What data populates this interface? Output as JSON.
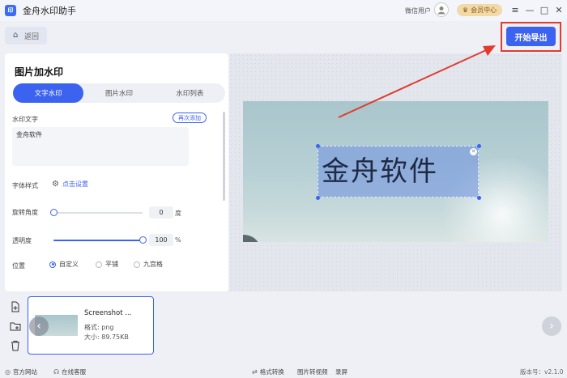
{
  "app": {
    "logo_text": "印",
    "title": "金舟水印助手"
  },
  "titlebar": {
    "user_name": "微信用户",
    "vip_label": "会员中心",
    "menu_icon": "≡",
    "minimize_icon": "—",
    "maximize_icon": "□",
    "close_icon": "✕"
  },
  "toolbar": {
    "back_label": "返回",
    "export_label": "开始导出"
  },
  "panel": {
    "title": "图片加水印",
    "tabs": [
      {
        "label": "文字水印",
        "active": true
      },
      {
        "label": "图片水印",
        "active": false
      },
      {
        "label": "水印列表",
        "active": false
      }
    ],
    "wm_text_label": "水印文字",
    "add_again_label": "再次添加",
    "wm_text_value": "金舟软件",
    "font_style_label": "字体样式",
    "font_setting_link": "点击设置",
    "rotation_label": "旋转角度",
    "rotation_value": "0",
    "rotation_unit": "度",
    "rotation_fraction": 0,
    "opacity_label": "透明度",
    "opacity_value": "100",
    "opacity_unit": "%",
    "opacity_fraction": 1,
    "position_label": "位置",
    "position_options": [
      {
        "label": "自定义",
        "checked": true
      },
      {
        "label": "平铺",
        "checked": false
      },
      {
        "label": "九宫格",
        "checked": false
      }
    ]
  },
  "preview": {
    "watermark_text": "金舟软件"
  },
  "file": {
    "name": "Screenshot ...",
    "format": "格式: png",
    "size": "大小: 89.75KB"
  },
  "status": {
    "items": [
      "官方网站",
      "在线客服",
      "格式转换",
      "图片转视频",
      "录屏"
    ],
    "version": "版本号：v2.1.0"
  },
  "colors": {
    "accent": "#3c63f0",
    "highlight": "#e23b2e"
  }
}
